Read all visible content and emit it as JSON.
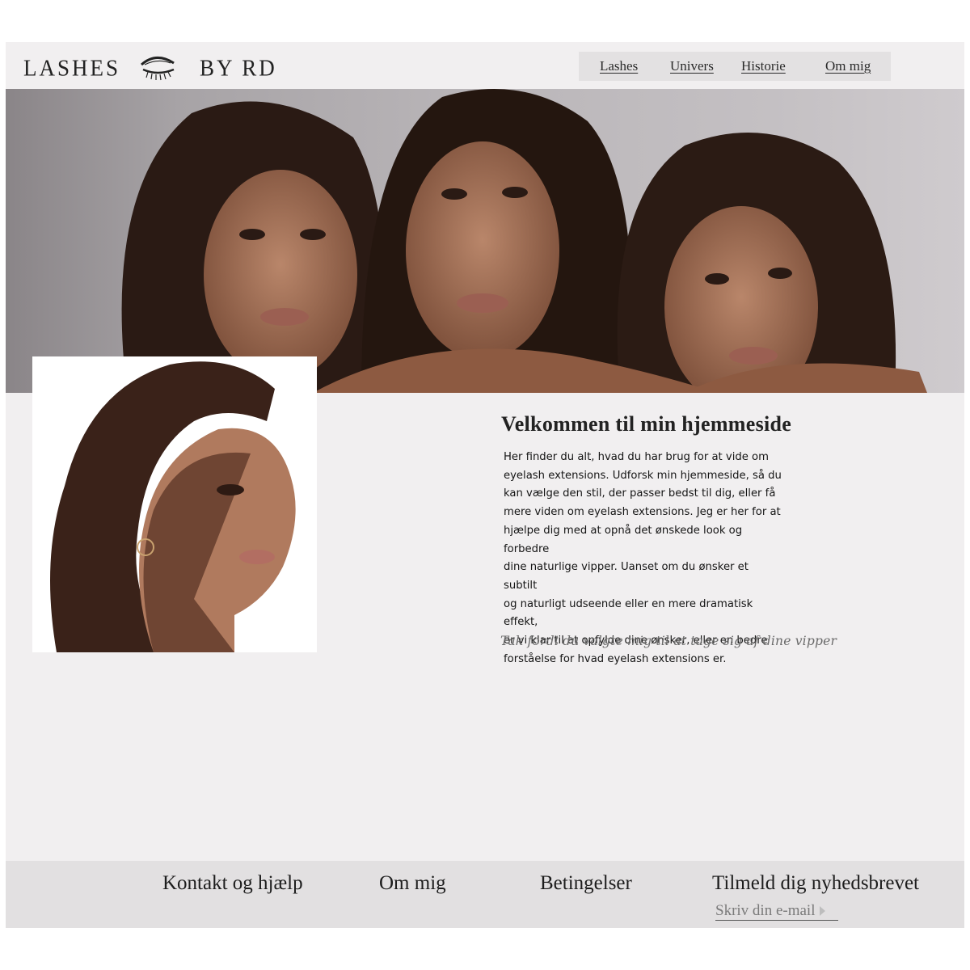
{
  "brand": {
    "logo_left": "LASHES",
    "logo_right": "BY RD"
  },
  "nav": {
    "items": [
      "Lashes",
      "Univers",
      "Historie",
      "Om mig"
    ]
  },
  "hero": {
    "image": "three-women-portrait"
  },
  "portrait": {
    "image": "woman-profile-shadow-portrait"
  },
  "welcome": {
    "title": "Velkommen til min hjemmeside",
    "body_lines": [
      "Her finder du alt, hvad du har brug for at vide om",
      "eyelash extensions. Udforsk min hjemmeside, så du",
      "kan vælge den stil, der passer bedst til dig, eller få",
      "mere viden om eyelash extensions. Jeg er her for at",
      "hjælpe dig med at opnå det ønskede look og forbedre",
      "dine naturlige vipper. Uanset om du ønsker et subtilt",
      "og naturligt udseende eller en mere dramatisk effekt,",
      "er vi klar til at opfylde dine ønsker, eller en bedre",
      "forståelse for hvad eyelash extensions er."
    ],
    "thanks": "Tak fordi du valgte mig til at tage sig af dine vipper"
  },
  "footer": {
    "contact": "Kontakt og hjælp",
    "about": "Om mig",
    "terms": "Betingelser",
    "newsletter": "Tilmeld dig nyhedsbrevet",
    "email_placeholder": "Skriv din e-mail"
  },
  "colors": {
    "page_bg": "#f1eff0",
    "nav_bg": "#e3e1e2",
    "footer_bg": "#e2e0e1",
    "text": "#1b1b1b"
  }
}
